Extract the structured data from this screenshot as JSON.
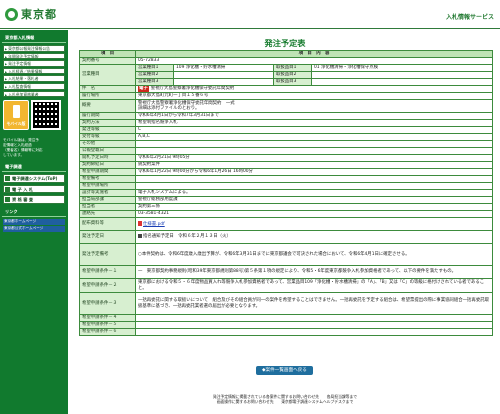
{
  "header": {
    "logo_text": "東京都",
    "service_title": "入札情報サービス"
  },
  "sidebar": {
    "section1": "東京都入札情報",
    "items": [
      "東京都公報発注情報公告",
      "年間発注予定情報",
      "発注予定情報",
      "入札経過／結果情報",
      "入札結果・落札者",
      "入札監査情報",
      "入札参加資格業者"
    ],
    "mobile_label": "モバイル版",
    "mobile_note": [
      "モバイル版は、発注予",
      "定情報と入札経過",
      "（業者名）情報等に対応",
      "しています。"
    ],
    "section2": "電子調達",
    "big_items": [
      "電子調達システム(ToP)",
      "電 子 入 札",
      "資 格 審 査"
    ],
    "section3": "リンク",
    "links": [
      "東京都ホームページ",
      "東京都公式ホームページ"
    ]
  },
  "main": {
    "title": "発注予定表",
    "col_item": "項　目",
    "col_content": "項　目　内　容",
    "rows": {
      "keiyaku_no": {
        "label": "契約番号",
        "value": "05-72833"
      },
      "eigyo_shumoku": {
        "label": "営業種目",
        "sub": [
          "営業種目1",
          "営業種目2",
          "営業種目3"
        ],
        "vals": [
          "109 浄化槽・貯水槽清掃",
          "",
          ""
        ],
        "tsub": [
          "取扱品目1",
          "取扱品目2",
          "取扱品目3"
        ],
        "tvals": [
          "01 浄化槽清掃・浄化槽保守点検",
          "",
          ""
        ]
      },
      "kenmei": {
        "label": "件　名",
        "badge": "電子",
        "value": "警視庁大島警察署浄化槽保守委託年間契約"
      },
      "basho": {
        "label": "履行場所",
        "value": "東京都大島町元町一丁目１５番６号"
      },
      "gaiyo": {
        "label": "概要",
        "line1": "警視庁大島警察署浄化槽保守委託年間契約　一式",
        "line2": "詳細は添付ファイルのとおり。"
      },
      "kikan": {
        "label": "履行期間",
        "value": "令和6年4月1日から令和7年3月31日まで"
      },
      "hoho": {
        "label": "契約方法",
        "value": "希望制指名競争入札"
      },
      "kubun": {
        "label": "発注等級",
        "value": "C"
      },
      "uketsuke": {
        "label": "受付等級",
        "value": "A,B,C"
      },
      "sonota": {
        "label": "その他",
        "value": ""
      },
      "koukai": {
        "label": "公報登載日",
        "value": ""
      },
      "kaihyo": {
        "label": "開札予定日時",
        "value": "令和6年2月21日 9時05分"
      },
      "jisshi": {
        "label": "契約締結日",
        "value": "鋭契約案件"
      },
      "kibo_kikan": {
        "label": "希望申請期間",
        "value": "令和6年1月22日 9時00分から令和6年1月26日 16時00分"
      },
      "kibo_biko": {
        "label": "希望備考",
        "value": ""
      },
      "shikaku": {
        "label": "希望申請場所",
        "value": ""
      },
      "sekkei": {
        "label": "設計等実施者",
        "value": "電子入札システムによる。"
      },
      "tanto": {
        "label": "担当局部課",
        "value": "警視庁総務部用度課"
      },
      "tanto_sha": {
        "label": "担当者",
        "value": "契約第三係"
      },
      "renraku": {
        "label": "連絡先",
        "value": "03-3581-4321"
      },
      "tenpu": {
        "label": "配布資料等",
        "value": "仕様書.pdf"
      },
      "hatchu_bi": {
        "label": "発注予定日",
        "check_label": "指名通知予定日",
        "value": "令和６年２月１３日（火）"
      },
      "hatchu_biko": {
        "label": "発注予定備考",
        "value": "○本件契約は、令和6年度歳入歳出予算が、令和6年3月31日までに東京都議会で可決された場合において、令和6年4月1日に確定させる。"
      },
      "jouken1": {
        "label": "希望申請条件－１",
        "value": "一　東京都契約事務規則(昭和39年東京都規則第88号)第５条第１項の規定により、令和5・6年度東京都競争入札参加資格者であって、以下の要件を満たすもの。"
      },
      "jouken2": {
        "label": "希望申請条件－２",
        "value": "東京都における令和５・６年度物品買入れ等競争入札参加資格者であって、営業品目109「浄化槽・貯水槽清掃」の「A」、「B」又は「C」の等級に格付けされている者であること。"
      },
      "jouken3": {
        "label": "希望申請条件－３",
        "value": "一括再委託に関する取扱いについて　組合及びその組合員が同一の案件を希望することはできません。一括再委託を予定する組合は、希望票提出の際に事業協同組合一括再委託取扱基準に基づき、一括再委託業者選の届出が必要となります。"
      },
      "jouken4": {
        "label": "希望申請条件－４",
        "value": ""
      },
      "jouken5": {
        "label": "希望申請条件－５",
        "value": ""
      },
      "jouken6": {
        "label": "希望申請条件－６",
        "value": ""
      }
    },
    "back_button": "◆案件一覧画面へ戻る",
    "footer": [
      "発注予定情報に掲載されている各案件に関するお問い合わせ先　　各局担当課等まで",
      "画面操作に関するお問い合わせ先　　東京都電子調達システムヘルプデスクまで"
    ]
  }
}
